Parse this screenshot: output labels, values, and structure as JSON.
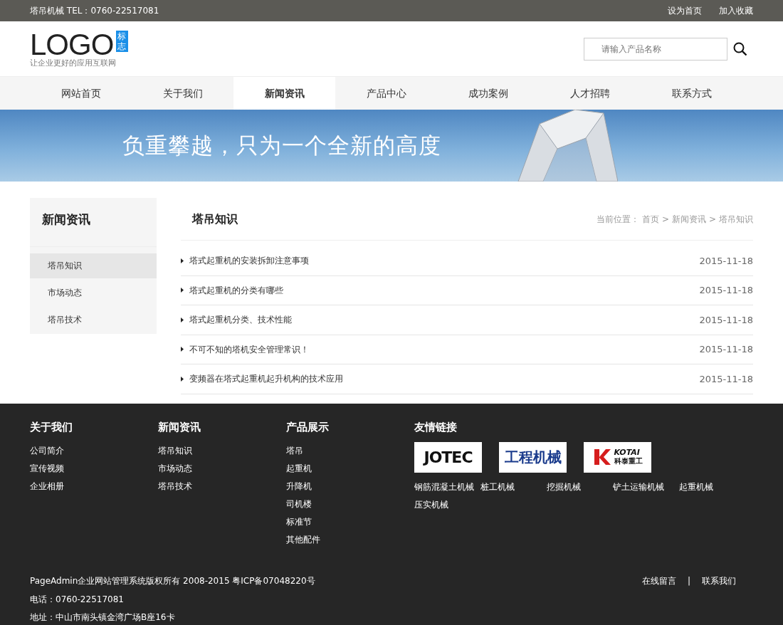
{
  "topbar": {
    "contact": "塔吊机械 TEL：0760-22517081",
    "links": [
      "设为首页",
      "加入收藏"
    ]
  },
  "header": {
    "logo": "LOGO",
    "logo_badge": "标志",
    "tagline": "让企业更好的应用互联网",
    "search": {
      "placeholder": "请输入产品名称"
    }
  },
  "nav": [
    {
      "label": "网站首页",
      "selected": false
    },
    {
      "label": "关于我们",
      "selected": false
    },
    {
      "label": "新闻资讯",
      "selected": true
    },
    {
      "label": "产品中心",
      "selected": false
    },
    {
      "label": "成功案例",
      "selected": false
    },
    {
      "label": "人才招聘",
      "selected": false
    },
    {
      "label": "联系方式",
      "selected": false
    }
  ],
  "banner": {
    "slogan": "负重攀越，只为一个全新的高度"
  },
  "sidebar": {
    "title": "新闻资讯",
    "items": [
      {
        "label": "塔吊知识",
        "selected": true
      },
      {
        "label": "市场动态",
        "selected": false
      },
      {
        "label": "塔吊技术",
        "selected": false
      }
    ]
  },
  "content": {
    "title": "塔吊知识",
    "breadcrumb": {
      "prefix": "当前位置：",
      "separator": ">",
      "items": [
        "首页",
        "新闻资讯",
        "塔吊知识"
      ]
    },
    "articles": [
      {
        "title": "塔式起重机的安装拆卸注意事项",
        "date": "2015-11-18"
      },
      {
        "title": "塔式起重机的分类有哪些",
        "date": "2015-11-18"
      },
      {
        "title": "塔式起重机分类、技术性能",
        "date": "2015-11-18"
      },
      {
        "title": "不可不知的塔机安全管理常识！",
        "date": "2015-11-18"
      },
      {
        "title": "变频器在塔式起重机起升机构的技术应用",
        "date": "2015-11-18"
      }
    ]
  },
  "footer": {
    "columns": [
      {
        "title": "关于我们",
        "links": [
          "公司简介",
          "宣传视频",
          "企业相册"
        ]
      },
      {
        "title": "新闻资讯",
        "links": [
          "塔吊知识",
          "市场动态",
          "塔吊技术"
        ]
      },
      {
        "title": "产品展示",
        "links": [
          "塔吊",
          "起重机",
          "升降机",
          "司机楼",
          "标准节",
          "其他配件"
        ]
      }
    ],
    "partners": {
      "title": "友情链接",
      "logos": [
        {
          "kind": "jotec",
          "text": "JOTEC"
        },
        {
          "kind": "gcjx",
          "text": "工程机械"
        },
        {
          "kind": "kotai",
          "text": "KOTAI",
          "subtext": "科泰重工"
        }
      ],
      "links": [
        "钢筋混凝土机械",
        "桩工机械",
        "挖掘机械",
        "铲土运输机械",
        "起重机械",
        "压实机械"
      ]
    },
    "copyright": "PageAdmin企业网站管理系统版权所有 2008-2015 粤ICP备07048220号",
    "phone": "电话：0760-22517081",
    "address": "地址：中山市南头镇金湾广场B座16卡",
    "bottom_links": [
      "在线留言",
      "联系我们"
    ],
    "bottom_separator": "|"
  }
}
